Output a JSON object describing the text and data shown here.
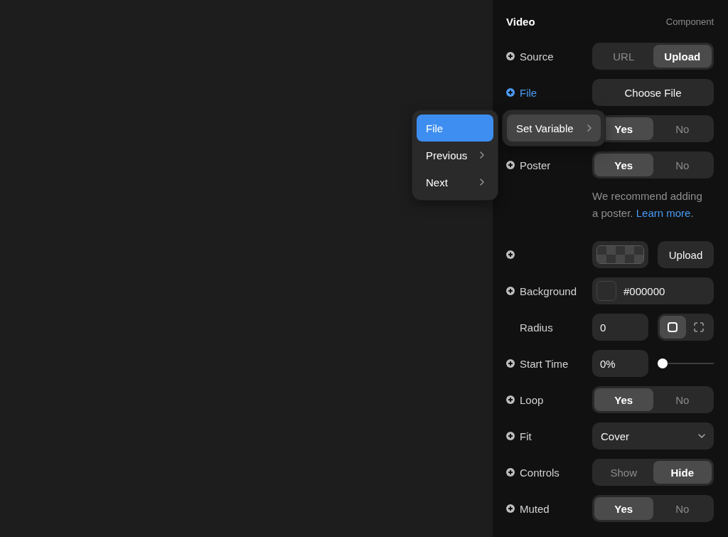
{
  "panel": {
    "title": "Video",
    "subtitle": "Component"
  },
  "rows": [
    {
      "kind": "segmented",
      "label": "Source",
      "plus": true,
      "active": false,
      "options": [
        {
          "label": "URL",
          "selected": false
        },
        {
          "label": "Upload",
          "selected": true
        }
      ]
    },
    {
      "kind": "button",
      "label": "File",
      "plus": true,
      "active": true,
      "button": "Choose File"
    },
    {
      "kind": "segmented",
      "plus": false,
      "options": [
        {
          "label": "Yes",
          "selected": true
        },
        {
          "label": "No",
          "selected": false
        }
      ]
    },
    {
      "kind": "segmented",
      "label": "Poster",
      "plus": true,
      "active": false,
      "options": [
        {
          "label": "Yes",
          "selected": true
        },
        {
          "label": "No",
          "selected": false
        }
      ]
    },
    {
      "kind": "note",
      "text": "We recommend adding a poster. ",
      "link": "Learn more",
      "suffix": "."
    },
    {
      "kind": "image",
      "plus": true,
      "active": false,
      "button": "Upload"
    },
    {
      "kind": "color",
      "label": "Background",
      "plus": true,
      "active": false,
      "value": "#000000"
    },
    {
      "kind": "radius",
      "label": "Radius",
      "plus": false,
      "active": false,
      "value": "0",
      "modes": [
        {
          "kind": "uniform",
          "selected": true
        },
        {
          "kind": "separate",
          "selected": false
        }
      ]
    },
    {
      "kind": "slider",
      "label": "Start Time",
      "plus": true,
      "active": false,
      "value": "0%",
      "level": 0
    },
    {
      "kind": "segmented",
      "label": "Loop",
      "plus": true,
      "active": false,
      "options": [
        {
          "label": "Yes",
          "selected": true
        },
        {
          "label": "No",
          "selected": false
        }
      ]
    },
    {
      "kind": "select",
      "label": "Fit",
      "plus": true,
      "active": false,
      "value": "Cover"
    },
    {
      "kind": "segmented",
      "label": "Controls",
      "plus": true,
      "active": false,
      "options": [
        {
          "label": "Show",
          "selected": false
        },
        {
          "label": "Hide",
          "selected": true
        }
      ]
    },
    {
      "kind": "segmented",
      "label": "Muted",
      "plus": true,
      "active": false,
      "options": [
        {
          "label": "Yes",
          "selected": true
        },
        {
          "label": "No",
          "selected": false
        }
      ]
    }
  ],
  "context_menu": {
    "items": [
      {
        "label": "Set Variable",
        "selected": true,
        "submenu": true
      }
    ]
  },
  "submenu": {
    "items": [
      {
        "label": "File",
        "selected": true,
        "submenu": false
      },
      {
        "label": "Previous",
        "selected": false,
        "submenu": true
      },
      {
        "label": "Next",
        "selected": false,
        "submenu": true
      }
    ]
  }
}
